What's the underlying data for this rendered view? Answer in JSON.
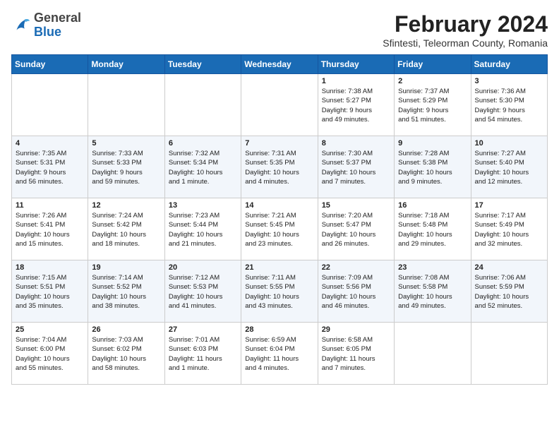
{
  "header": {
    "logo_general": "General",
    "logo_blue": "Blue",
    "title": "February 2024",
    "location": "Sfintesti, Teleorman County, Romania"
  },
  "days_of_week": [
    "Sunday",
    "Monday",
    "Tuesday",
    "Wednesday",
    "Thursday",
    "Friday",
    "Saturday"
  ],
  "weeks": [
    [
      {
        "day": "",
        "info": ""
      },
      {
        "day": "",
        "info": ""
      },
      {
        "day": "",
        "info": ""
      },
      {
        "day": "",
        "info": ""
      },
      {
        "day": "1",
        "info": "Sunrise: 7:38 AM\nSunset: 5:27 PM\nDaylight: 9 hours\nand 49 minutes."
      },
      {
        "day": "2",
        "info": "Sunrise: 7:37 AM\nSunset: 5:29 PM\nDaylight: 9 hours\nand 51 minutes."
      },
      {
        "day": "3",
        "info": "Sunrise: 7:36 AM\nSunset: 5:30 PM\nDaylight: 9 hours\nand 54 minutes."
      }
    ],
    [
      {
        "day": "4",
        "info": "Sunrise: 7:35 AM\nSunset: 5:31 PM\nDaylight: 9 hours\nand 56 minutes."
      },
      {
        "day": "5",
        "info": "Sunrise: 7:33 AM\nSunset: 5:33 PM\nDaylight: 9 hours\nand 59 minutes."
      },
      {
        "day": "6",
        "info": "Sunrise: 7:32 AM\nSunset: 5:34 PM\nDaylight: 10 hours\nand 1 minute."
      },
      {
        "day": "7",
        "info": "Sunrise: 7:31 AM\nSunset: 5:35 PM\nDaylight: 10 hours\nand 4 minutes."
      },
      {
        "day": "8",
        "info": "Sunrise: 7:30 AM\nSunset: 5:37 PM\nDaylight: 10 hours\nand 7 minutes."
      },
      {
        "day": "9",
        "info": "Sunrise: 7:28 AM\nSunset: 5:38 PM\nDaylight: 10 hours\nand 9 minutes."
      },
      {
        "day": "10",
        "info": "Sunrise: 7:27 AM\nSunset: 5:40 PM\nDaylight: 10 hours\nand 12 minutes."
      }
    ],
    [
      {
        "day": "11",
        "info": "Sunrise: 7:26 AM\nSunset: 5:41 PM\nDaylight: 10 hours\nand 15 minutes."
      },
      {
        "day": "12",
        "info": "Sunrise: 7:24 AM\nSunset: 5:42 PM\nDaylight: 10 hours\nand 18 minutes."
      },
      {
        "day": "13",
        "info": "Sunrise: 7:23 AM\nSunset: 5:44 PM\nDaylight: 10 hours\nand 21 minutes."
      },
      {
        "day": "14",
        "info": "Sunrise: 7:21 AM\nSunset: 5:45 PM\nDaylight: 10 hours\nand 23 minutes."
      },
      {
        "day": "15",
        "info": "Sunrise: 7:20 AM\nSunset: 5:47 PM\nDaylight: 10 hours\nand 26 minutes."
      },
      {
        "day": "16",
        "info": "Sunrise: 7:18 AM\nSunset: 5:48 PM\nDaylight: 10 hours\nand 29 minutes."
      },
      {
        "day": "17",
        "info": "Sunrise: 7:17 AM\nSunset: 5:49 PM\nDaylight: 10 hours\nand 32 minutes."
      }
    ],
    [
      {
        "day": "18",
        "info": "Sunrise: 7:15 AM\nSunset: 5:51 PM\nDaylight: 10 hours\nand 35 minutes."
      },
      {
        "day": "19",
        "info": "Sunrise: 7:14 AM\nSunset: 5:52 PM\nDaylight: 10 hours\nand 38 minutes."
      },
      {
        "day": "20",
        "info": "Sunrise: 7:12 AM\nSunset: 5:53 PM\nDaylight: 10 hours\nand 41 minutes."
      },
      {
        "day": "21",
        "info": "Sunrise: 7:11 AM\nSunset: 5:55 PM\nDaylight: 10 hours\nand 43 minutes."
      },
      {
        "day": "22",
        "info": "Sunrise: 7:09 AM\nSunset: 5:56 PM\nDaylight: 10 hours\nand 46 minutes."
      },
      {
        "day": "23",
        "info": "Sunrise: 7:08 AM\nSunset: 5:58 PM\nDaylight: 10 hours\nand 49 minutes."
      },
      {
        "day": "24",
        "info": "Sunrise: 7:06 AM\nSunset: 5:59 PM\nDaylight: 10 hours\nand 52 minutes."
      }
    ],
    [
      {
        "day": "25",
        "info": "Sunrise: 7:04 AM\nSunset: 6:00 PM\nDaylight: 10 hours\nand 55 minutes."
      },
      {
        "day": "26",
        "info": "Sunrise: 7:03 AM\nSunset: 6:02 PM\nDaylight: 10 hours\nand 58 minutes."
      },
      {
        "day": "27",
        "info": "Sunrise: 7:01 AM\nSunset: 6:03 PM\nDaylight: 11 hours\nand 1 minute."
      },
      {
        "day": "28",
        "info": "Sunrise: 6:59 AM\nSunset: 6:04 PM\nDaylight: 11 hours\nand 4 minutes."
      },
      {
        "day": "29",
        "info": "Sunrise: 6:58 AM\nSunset: 6:05 PM\nDaylight: 11 hours\nand 7 minutes."
      },
      {
        "day": "",
        "info": ""
      },
      {
        "day": "",
        "info": ""
      }
    ]
  ]
}
